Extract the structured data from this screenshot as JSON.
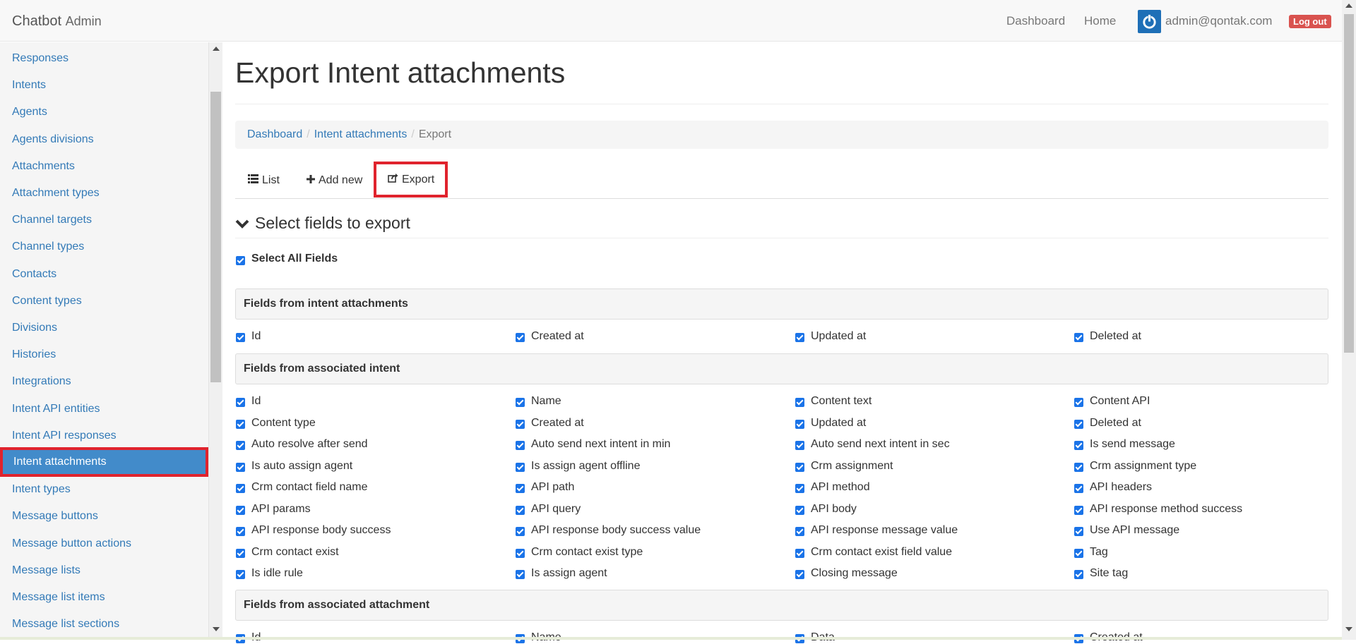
{
  "navbar": {
    "brand": "Chatbot",
    "brand_sub": "Admin",
    "dashboard": "Dashboard",
    "home": "Home",
    "user": "admin@qontak.com",
    "logout": "Log out"
  },
  "sidebar": {
    "items": [
      {
        "label": "Responses"
      },
      {
        "label": "Intents"
      },
      {
        "label": "Agents"
      },
      {
        "label": "Agents divisions"
      },
      {
        "label": "Attachments"
      },
      {
        "label": "Attachment types"
      },
      {
        "label": "Channel targets"
      },
      {
        "label": "Channel types"
      },
      {
        "label": "Contacts"
      },
      {
        "label": "Content types"
      },
      {
        "label": "Divisions"
      },
      {
        "label": "Histories"
      },
      {
        "label": "Integrations"
      },
      {
        "label": "Intent API entities"
      },
      {
        "label": "Intent API responses"
      },
      {
        "label": "Intent attachments"
      },
      {
        "label": "Intent types"
      },
      {
        "label": "Message buttons"
      },
      {
        "label": "Message button actions"
      },
      {
        "label": "Message lists"
      },
      {
        "label": "Message list items"
      },
      {
        "label": "Message list sections"
      }
    ],
    "active_index": 15
  },
  "page": {
    "title": "Export Intent attachments",
    "breadcrumb": [
      "Dashboard",
      "Intent attachments",
      "Export"
    ],
    "tabs": [
      "List",
      "Add new",
      "Export"
    ],
    "section": "Select fields to export",
    "select_all": "Select All Fields"
  },
  "groups": [
    {
      "title": "Fields from intent attachments",
      "fields": [
        "Id",
        "Created at",
        "Updated at",
        "Deleted at"
      ]
    },
    {
      "title": "Fields from associated intent",
      "fields": [
        "Id",
        "Name",
        "Content text",
        "Content API",
        "Content type",
        "Created at",
        "Updated at",
        "Deleted at",
        "Auto resolve after send",
        "Auto send next intent in min",
        "Auto send next intent in sec",
        "Is send message",
        "Is auto assign agent",
        "Is assign agent offline",
        "Crm assignment",
        "Crm assignment type",
        "Crm contact field name",
        "API path",
        "API method",
        "API headers",
        "API params",
        "API query",
        "API body",
        "API response method success",
        "API response body success",
        "API response body success value",
        "API response message value",
        "Use API message",
        "Crm contact exist",
        "Crm contact exist type",
        "Crm contact exist field value",
        "Tag",
        "Is idle rule",
        "Is assign agent",
        "Closing message",
        "Site tag"
      ]
    },
    {
      "title": "Fields from associated attachment",
      "fields": [
        "Id",
        "Name",
        "Data",
        "Created at"
      ]
    }
  ],
  "colors": {
    "link": "#337ab7",
    "active_bg": "#428bca",
    "highlight_border": "#e0232d",
    "checkbox": "#1a73e8",
    "logout": "#d9534f"
  }
}
